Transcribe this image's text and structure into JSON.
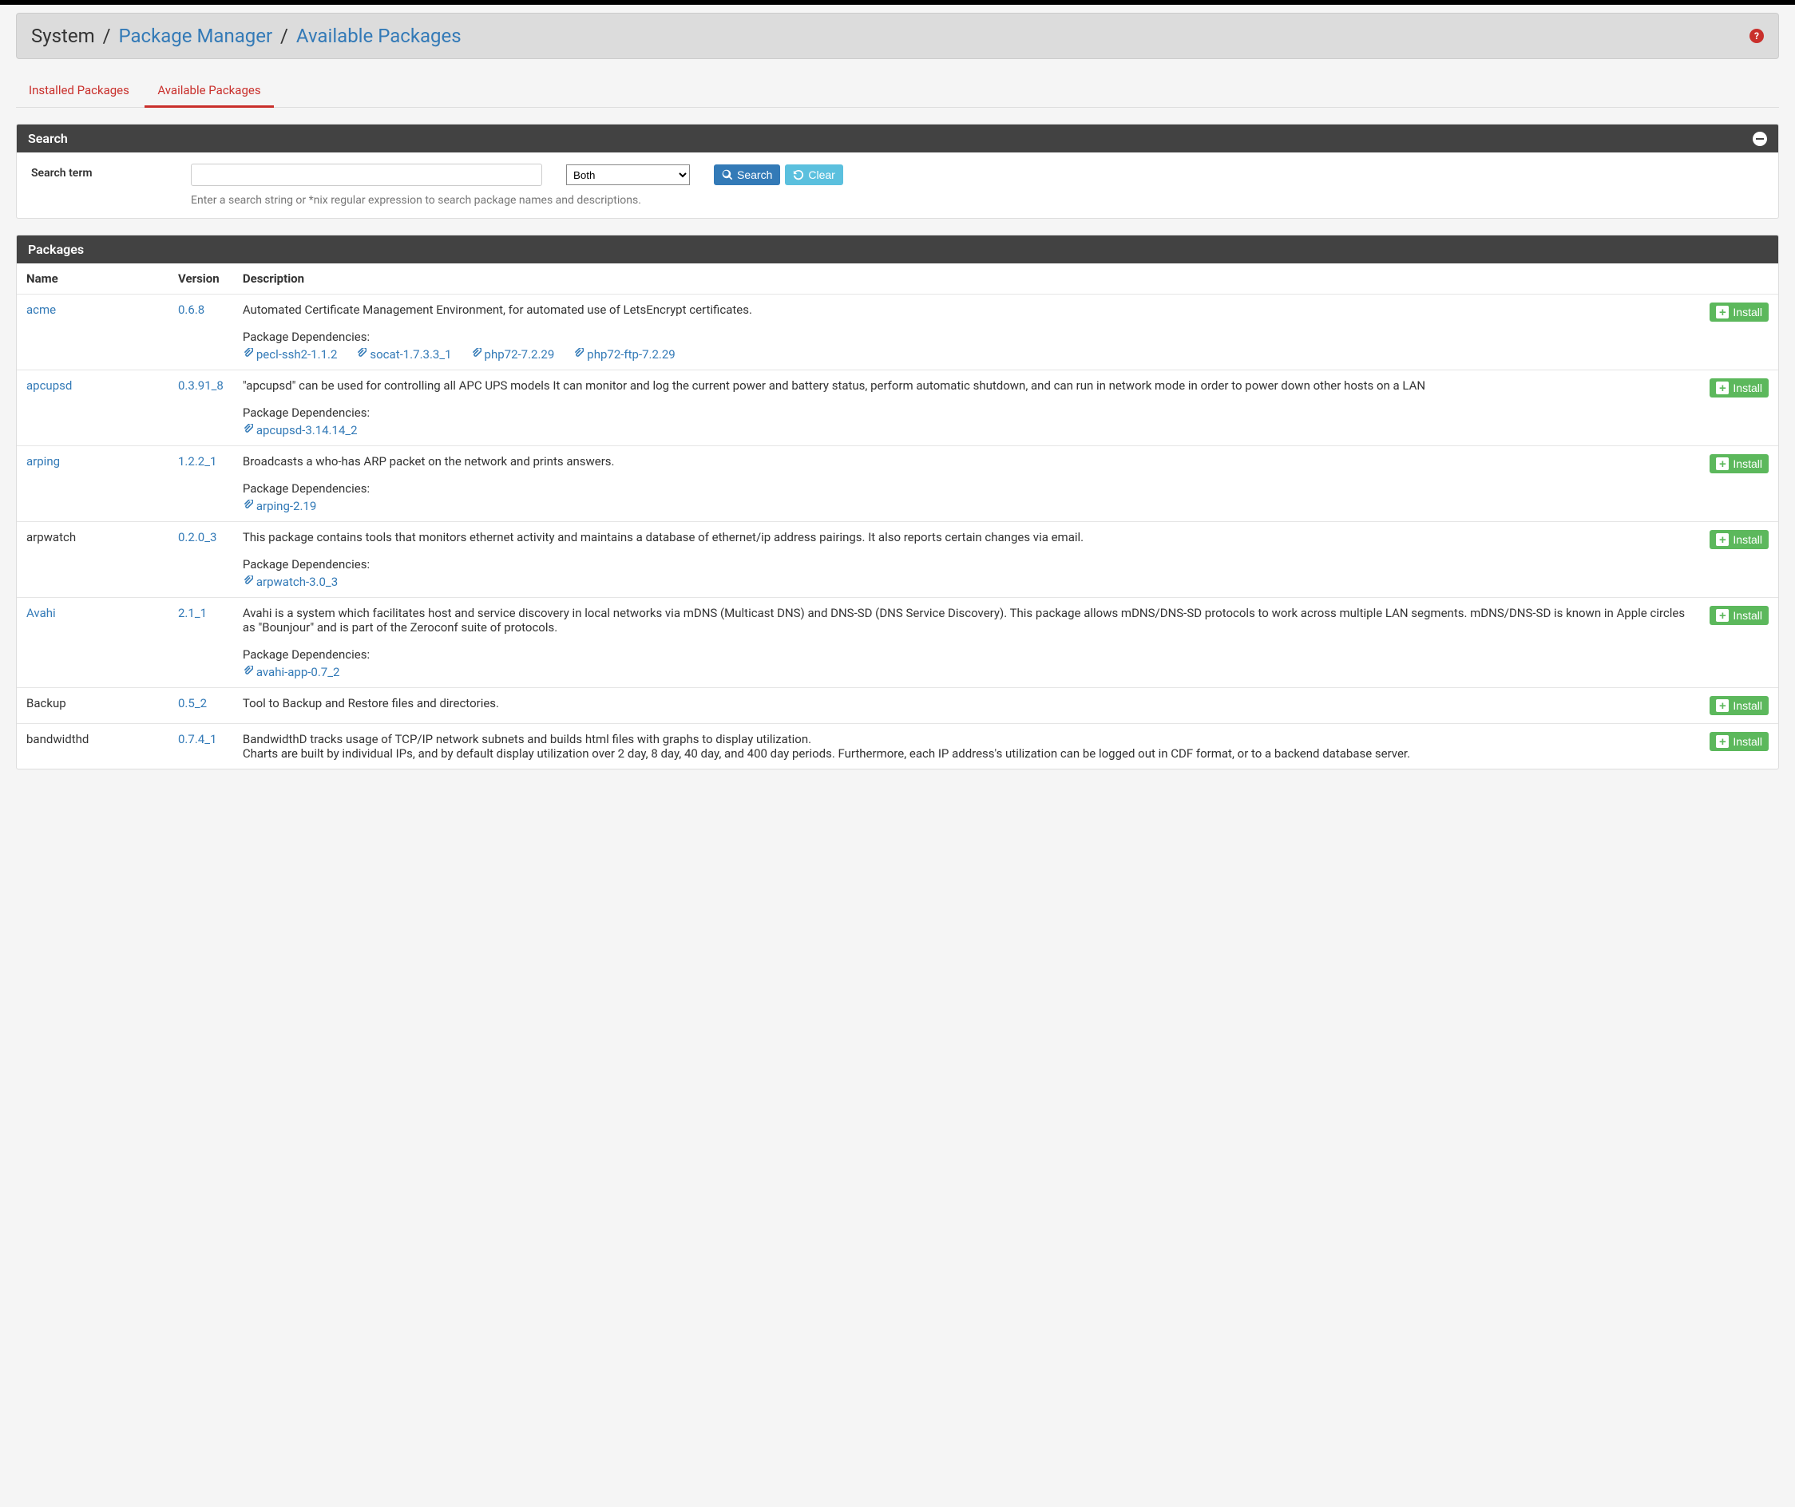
{
  "breadcrumb": {
    "root": "System",
    "section": "Package Manager",
    "page": "Available Packages"
  },
  "tabs": {
    "installed": "Installed Packages",
    "available": "Available Packages"
  },
  "search_panel": {
    "title": "Search",
    "label": "Search term",
    "input_value": "",
    "select_value": "Both",
    "search_btn": "Search",
    "clear_btn": "Clear",
    "help": "Enter a search string or *nix regular expression to search package names and descriptions."
  },
  "packages_panel": {
    "title": "Packages",
    "columns": {
      "name": "Name",
      "version": "Version",
      "description": "Description"
    },
    "deps_label": "Package Dependencies:",
    "install_label": "Install"
  },
  "packages": [
    {
      "name": "acme",
      "name_is_link": true,
      "version": "0.6.8",
      "description": "Automated Certificate Management Environment, for automated use of LetsEncrypt certificates.",
      "deps": [
        "pecl-ssh2-1.1.2",
        "socat-1.7.3.3_1",
        "php72-7.2.29",
        "php72-ftp-7.2.29"
      ]
    },
    {
      "name": "apcupsd",
      "name_is_link": true,
      "version": "0.3.91_8",
      "description": "\"apcupsd\" can be used for controlling all APC UPS models It can monitor and log the current power and battery status, perform automatic shutdown, and can run in network mode in order to power down other hosts on a LAN",
      "deps": [
        "apcupsd-3.14.14_2"
      ]
    },
    {
      "name": "arping",
      "name_is_link": true,
      "version": "1.2.2_1",
      "description": "Broadcasts a who-has ARP packet on the network and prints answers.",
      "deps": [
        "arping-2.19"
      ]
    },
    {
      "name": "arpwatch",
      "name_is_link": false,
      "version": "0.2.0_3",
      "description": "This package contains tools that monitors ethernet activity and maintains a database of ethernet/ip address pairings. It also reports certain changes via email.",
      "deps": [
        "arpwatch-3.0_3"
      ]
    },
    {
      "name": "Avahi",
      "name_is_link": true,
      "version": "2.1_1",
      "description": "Avahi is a system which facilitates host and service discovery in local networks via mDNS (Multicast DNS) and DNS-SD (DNS Service Discovery). This package allows mDNS/DNS-SD protocols to work across multiple LAN segments. mDNS/DNS-SD is known in Apple circles as \"Bounjour\" and is part of the Zeroconf suite of protocols.",
      "deps": [
        "avahi-app-0.7_2"
      ]
    },
    {
      "name": "Backup",
      "name_is_link": false,
      "version": "0.5_2",
      "description": "Tool to Backup and Restore files and directories.",
      "deps": []
    },
    {
      "name": "bandwidthd",
      "name_is_link": false,
      "version": "0.7.4_1",
      "description": "BandwidthD tracks usage of TCP/IP network subnets and builds html files with graphs to display utilization.\nCharts are built by individual IPs, and by default display utilization over 2 day, 8 day, 40 day, and 400 day periods. Furthermore, each IP address's utilization can be logged out in CDF format, or to a backend database server.",
      "deps": []
    }
  ]
}
